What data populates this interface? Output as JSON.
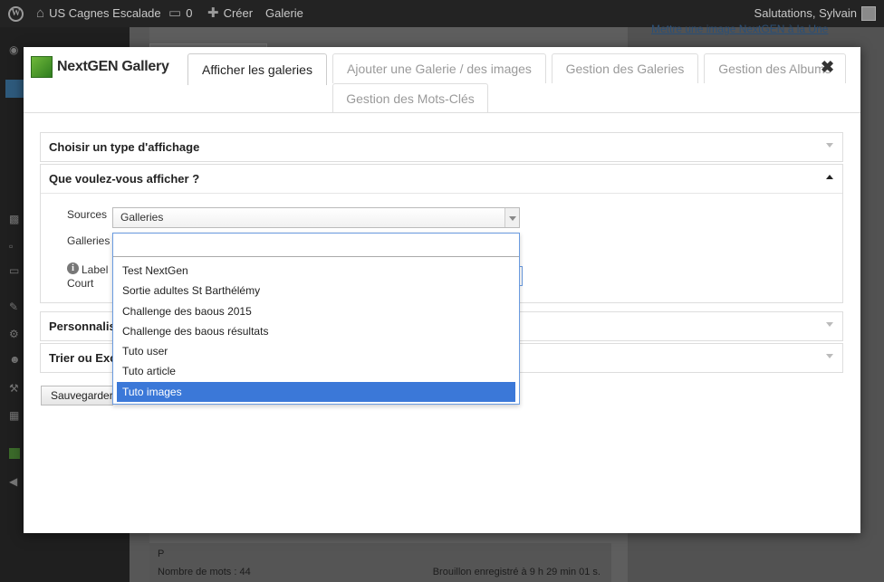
{
  "adminbar": {
    "site_name": "US Cagnes Escalade",
    "comments_count": "0",
    "create_label": "Créer",
    "gallery_label": "Galerie",
    "greeting": "Salutations, Sylvain"
  },
  "background": {
    "side_link": "Mettre une image NextGEN à la Une",
    "footer_p": "P",
    "word_count": "Nombre de mots : 44",
    "draft_status": "Brouillon enregistré à 9 h 29 min 01 s."
  },
  "modal": {
    "brand": "NextGEN Gallery",
    "tabs": [
      {
        "label": "Afficher les galeries"
      },
      {
        "label": "Ajouter une Galerie / des images"
      },
      {
        "label": "Gestion des Galeries"
      },
      {
        "label": "Gestion des Albums"
      },
      {
        "label": "Gestion des Mots-Clés"
      }
    ],
    "sections": {
      "display_type": "Choisir un type d'affichage",
      "what_to_show": "Que voulez-vous afficher ?",
      "customize": "Personnalis",
      "sort": "Trier ou Exc"
    },
    "fields": {
      "sources_label": "Sources",
      "sources_value": "Galleries",
      "galleries_label": "Galleries",
      "label_line1": "Label",
      "label_line2": "Court"
    },
    "dropdown": {
      "search_value": "",
      "options": [
        {
          "label": "Test NextGen"
        },
        {
          "label": "Sortie adultes St Barthélémy"
        },
        {
          "label": "Challenge des baous 2015"
        },
        {
          "label": "Challenge des baous résultats"
        },
        {
          "label": "Tuto user"
        },
        {
          "label": "Tuto article"
        },
        {
          "label": "Tuto images"
        }
      ],
      "selected": "Tuto images"
    },
    "save_label": "Sauvegarder"
  },
  "colors": {
    "accent": "#3b78d8",
    "adminbar": "#232323",
    "brand_green": "#4e9a2a"
  }
}
